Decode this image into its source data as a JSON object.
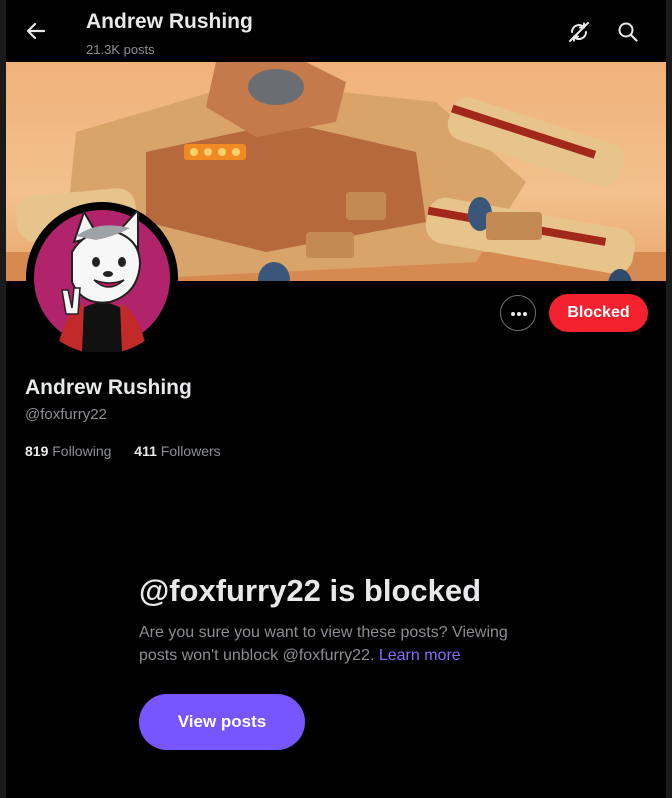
{
  "header": {
    "title": "Andrew Rushing",
    "posts_count": "21.3K posts",
    "icons": [
      "back-arrow-icon",
      "sync-off-icon",
      "search-icon"
    ]
  },
  "profile": {
    "name": "Andrew Rushing",
    "handle": "@foxfurry22",
    "following_count": "819",
    "following_label": "Following",
    "followers_count": "411",
    "followers_label": "Followers",
    "more_icon": "more-dots-icon",
    "blocked_label": "Blocked"
  },
  "blocked_notice": {
    "title": "@foxfurry22 is blocked",
    "description": "Are you sure you want to view these posts? Viewing posts won't unblock @foxfurry22.",
    "learn_more": "Learn more",
    "view_button": "View posts"
  },
  "colors": {
    "background": "#000000",
    "blocked_button": "#f4212e",
    "accent": "#7856ff",
    "link": "#8f68ff",
    "muted_text": "#8b8f94"
  }
}
